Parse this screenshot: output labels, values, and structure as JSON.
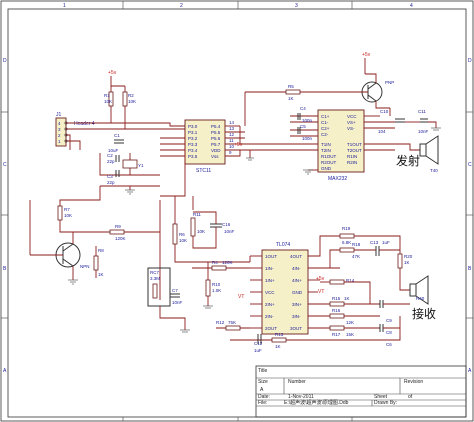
{
  "border": {
    "columns": [
      "1",
      "2",
      "3",
      "4"
    ],
    "rows": [
      "D",
      "C",
      "B",
      "A"
    ]
  },
  "j1": {
    "ref": "J1",
    "part": "Header 4"
  },
  "u1": {
    "ref": "STC11",
    "left_pins": [
      "P3.0",
      "P3.1",
      "P3.2",
      "P3.3",
      "P3.4",
      "P3.5"
    ],
    "right_pins": [
      "P5.4",
      "P5.5",
      "P5.6",
      "P5.7",
      "VDD",
      "Vss"
    ],
    "top_pin": "P5.3/RST"
  },
  "u2": {
    "ref": "MAX232",
    "left_pins": [
      "C1+",
      "C1-",
      "C2+",
      "C2-",
      "T1IN",
      "T2IN",
      "R1OUT",
      "R2OUT",
      "GND"
    ],
    "right_pins": [
      "VCC",
      "VS+",
      "VS-",
      "T1OUT",
      "T2OUT",
      "R1IN",
      "R2IN"
    ]
  },
  "u3": {
    "ref": "TL074",
    "left_pins": [
      "1OUT",
      "1IN-",
      "1IN+",
      "VCC",
      "2IN+",
      "2IN-",
      "2OUT"
    ],
    "right_pins": [
      "4OUT",
      "4IN-",
      "4IN+",
      "GND",
      "3IN+",
      "3IN-",
      "3OUT"
    ]
  },
  "parts": {
    "r1": "R1",
    "r1v": "10K",
    "r2": "R2",
    "r2v": "10K",
    "r3": "R3",
    "r3v": "1K",
    "r4": "R4",
    "r4v": "120K",
    "r5": "R5",
    "r5v": "1K",
    "r6": "R6",
    "r6v": "10K",
    "r7": "R7",
    "r7v": "10K",
    "r8": "R8",
    "r8v": "1K",
    "r9": "R9",
    "r9v": "120K",
    "r10": "R10",
    "r10v": "1.0K",
    "r11": "R11",
    "r11v": "10K",
    "r12": "R12",
    "r12v": "75K",
    "r13": "R13",
    "r13v": "1K",
    "r14": "R14",
    "r14v": "1K",
    "r15": "R15",
    "r15v": "1K",
    "r16": "R16",
    "r16v": "12K",
    "r17": "R17",
    "r17v": "15K",
    "r18": "R18",
    "r18v": "47K",
    "r19": "R19",
    "r19v": "6.8K",
    "r20": "R20",
    "r20v": "1K",
    "rc7": "RC7",
    "rc7v": "3.3M",
    "c1": "C1",
    "c1v": "10uF",
    "c2": "C2",
    "c2v": "22p",
    "c3": "C3",
    "c3v": "22p",
    "c4": "C4",
    "c5": "C5",
    "c6": "C6",
    "c7": "C7",
    "c7v": "10nF",
    "c8": "C8",
    "c9": "C9",
    "c10": "C10",
    "c10v": "104",
    "c11": "C11",
    "c11v": "10nF",
    "c12": "C12",
    "c13": "C13",
    "c13v": "1uF",
    "c16": "C16",
    "c16v": "10nF",
    "cap_v": "100n",
    "y1": "Y1",
    "q_pnp": "PNP",
    "q_npn": "NPN",
    "t40": "T40",
    "r40": "R40",
    "vcc5": "+5v",
    "vt": "VT"
  },
  "annotations": {
    "transmit": "发射",
    "receive": "接收"
  },
  "title_block": {
    "title": "Title",
    "size": "Size",
    "size_val": "A",
    "number": "Number",
    "revision": "Revision",
    "date": "Date:",
    "date_val": "1-Nov-2011",
    "sheet": "Sheet",
    "of": "of",
    "file": "File:",
    "file_val": "E:\\超声波\\超声波\\原理图.Ddb",
    "drawn_by": "Drawn By:"
  }
}
